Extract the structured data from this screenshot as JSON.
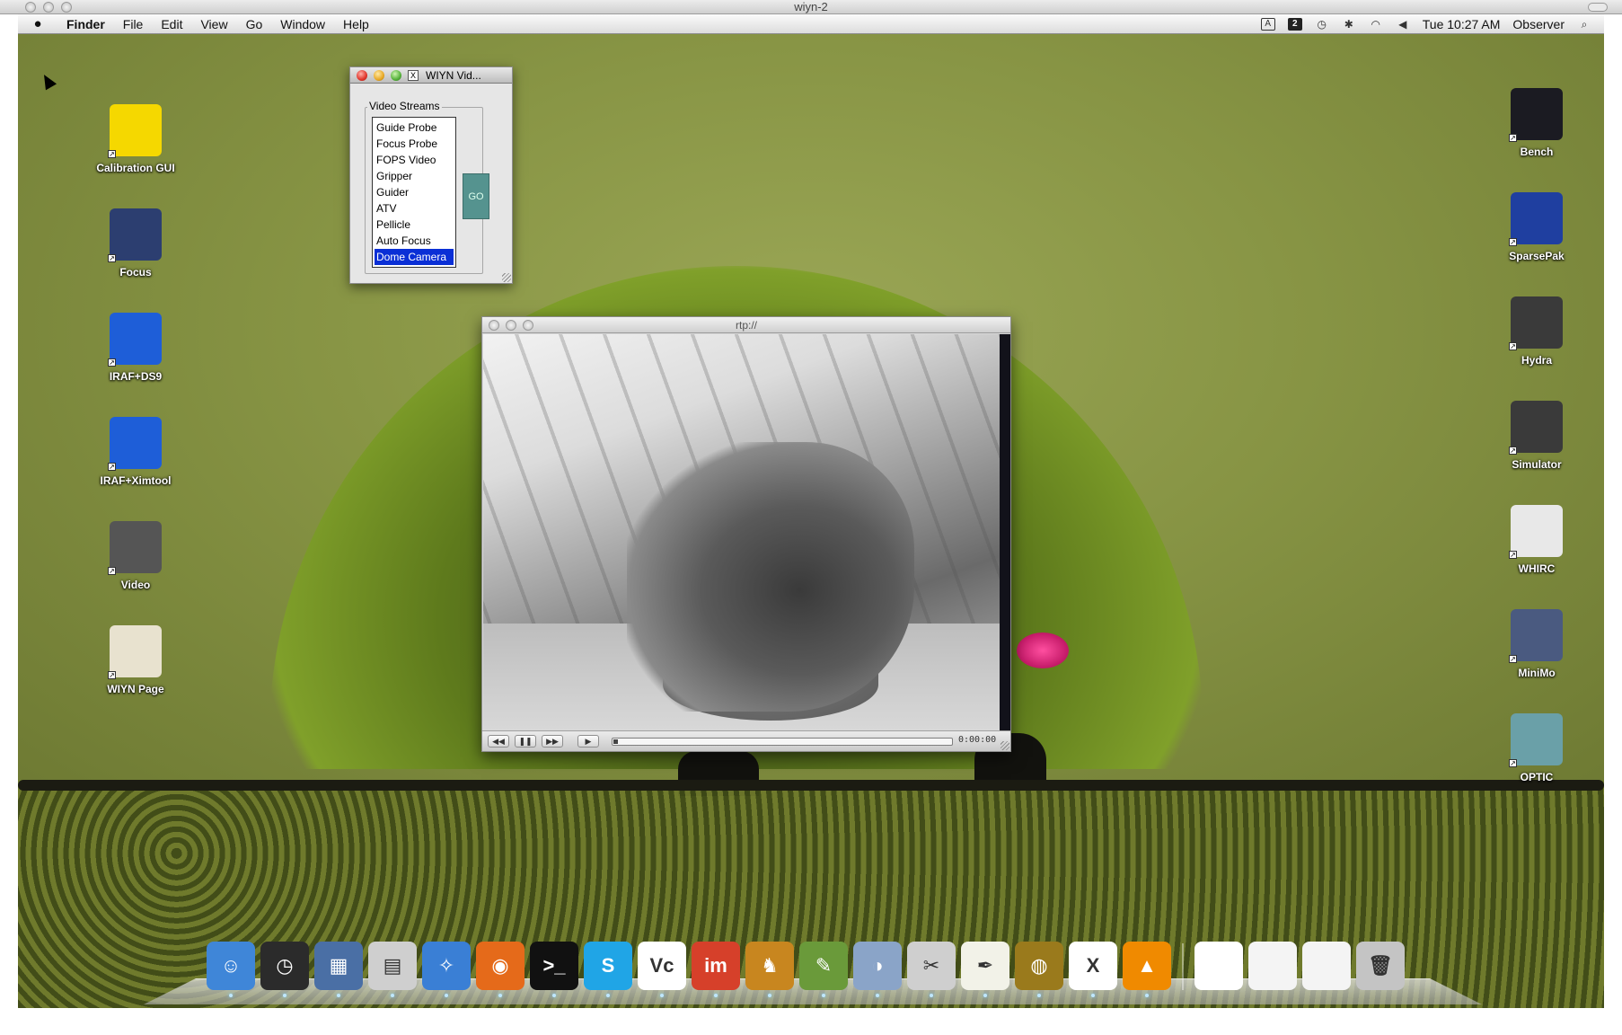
{
  "host_window": {
    "title": "wiyn-2"
  },
  "menubar": {
    "app": "Finder",
    "items": [
      "File",
      "Edit",
      "View",
      "Go",
      "Window",
      "Help"
    ],
    "status_box": "A",
    "status_dark": "2",
    "clock": "Tue 10:27 AM",
    "user": "Observer"
  },
  "desktop_left": [
    {
      "label": "Calibration GUI",
      "icon": "lightbulb-icon",
      "color": "#f5d800"
    },
    {
      "label": "Focus",
      "icon": "camera-lens-icon",
      "color": "#2c3e70"
    },
    {
      "label": "IRAF+DS9",
      "icon": "iraf-icon",
      "color": "#1e5ed8"
    },
    {
      "label": "IRAF+Ximtool",
      "icon": "iraf-icon",
      "color": "#1e5ed8"
    },
    {
      "label": "Video",
      "icon": "tv-icon",
      "color": "#555555"
    },
    {
      "label": "WIYN Page",
      "icon": "document-quill-icon",
      "color": "#e8e2cf"
    }
  ],
  "desktop_right": [
    {
      "label": "Bench",
      "icon": "spectrum-icon",
      "color": "#1b1b22"
    },
    {
      "label": "SparsePak",
      "icon": "fiber-bundle-icon",
      "color": "#1f3fa0"
    },
    {
      "label": "Hydra",
      "icon": "instrument-icon",
      "color": "#3a3a3a"
    },
    {
      "label": "Simulator",
      "icon": "instrument-icon",
      "color": "#3a3a3a"
    },
    {
      "label": "WHIRC",
      "icon": "camera-icon",
      "color": "#e8e8e8"
    },
    {
      "label": "MiniMo",
      "icon": "instrument-icon",
      "color": "#4a5a80"
    },
    {
      "label": "OPTIC",
      "icon": "instrument-icon",
      "color": "#6aa0a8"
    }
  ],
  "video_window": {
    "title": "WIYN Vid...",
    "group_label": "Video Streams",
    "streams": [
      "Guide Probe",
      "Focus Probe",
      "FOPS Video",
      "Gripper",
      "Guider",
      "ATV",
      "Pellicle",
      "Auto Focus",
      "Dome Camera"
    ],
    "selected": "Dome Camera",
    "go_label": "GO"
  },
  "player": {
    "title": "rtp://",
    "time": "0:00:00",
    "progress": 0
  },
  "dock": [
    {
      "name": "finder-icon",
      "color": "#3f86d8",
      "glyph": "☺"
    },
    {
      "name": "dashboard-icon",
      "color": "#2b2b2b",
      "glyph": "◷"
    },
    {
      "name": "expose-icon",
      "color": "#4a6fa5",
      "glyph": "▦"
    },
    {
      "name": "calculator-icon",
      "color": "#cfcfcf",
      "glyph": "▤"
    },
    {
      "name": "safari-icon",
      "color": "#3a7fd5",
      "glyph": "✧"
    },
    {
      "name": "firefox-icon",
      "color": "#e56a1a",
      "glyph": "◉"
    },
    {
      "name": "terminal-icon",
      "color": "#111111",
      "glyph": ">_"
    },
    {
      "name": "skype-icon",
      "color": "#20a5e6",
      "glyph": "S"
    },
    {
      "name": "vnc-icon",
      "color": "#ffffff",
      "glyph": "Vc"
    },
    {
      "name": "imagemagick-icon",
      "color": "#d6402a",
      "glyph": "im"
    },
    {
      "name": "cyberduck-icon",
      "color": "#c8861f",
      "glyph": "♞"
    },
    {
      "name": "pencil-icon",
      "color": "#6a9a3a",
      "glyph": "✎"
    },
    {
      "name": "preview-icon",
      "color": "#8aa4c8",
      "glyph": "◑"
    },
    {
      "name": "scissors-icon",
      "color": "#cfcfcf",
      "glyph": "✂"
    },
    {
      "name": "textedit-icon",
      "color": "#f2f2e8",
      "glyph": "✒"
    },
    {
      "name": "radar-icon",
      "color": "#9a7a1c",
      "glyph": "◍"
    },
    {
      "name": "x11-icon",
      "color": "#ffffff",
      "glyph": "X"
    },
    {
      "name": "vlc-icon",
      "color": "#f08a00",
      "glyph": "▲"
    },
    {
      "name": "minimized-window-icon",
      "color": "#ffffff",
      "glyph": ""
    },
    {
      "name": "minimized-window-icon",
      "color": "#f4f4f4",
      "glyph": ""
    },
    {
      "name": "minimized-window-icon",
      "color": "#f4f4f4",
      "glyph": ""
    },
    {
      "name": "trash-icon",
      "color": "#c4c4c4",
      "glyph": "🗑"
    }
  ]
}
